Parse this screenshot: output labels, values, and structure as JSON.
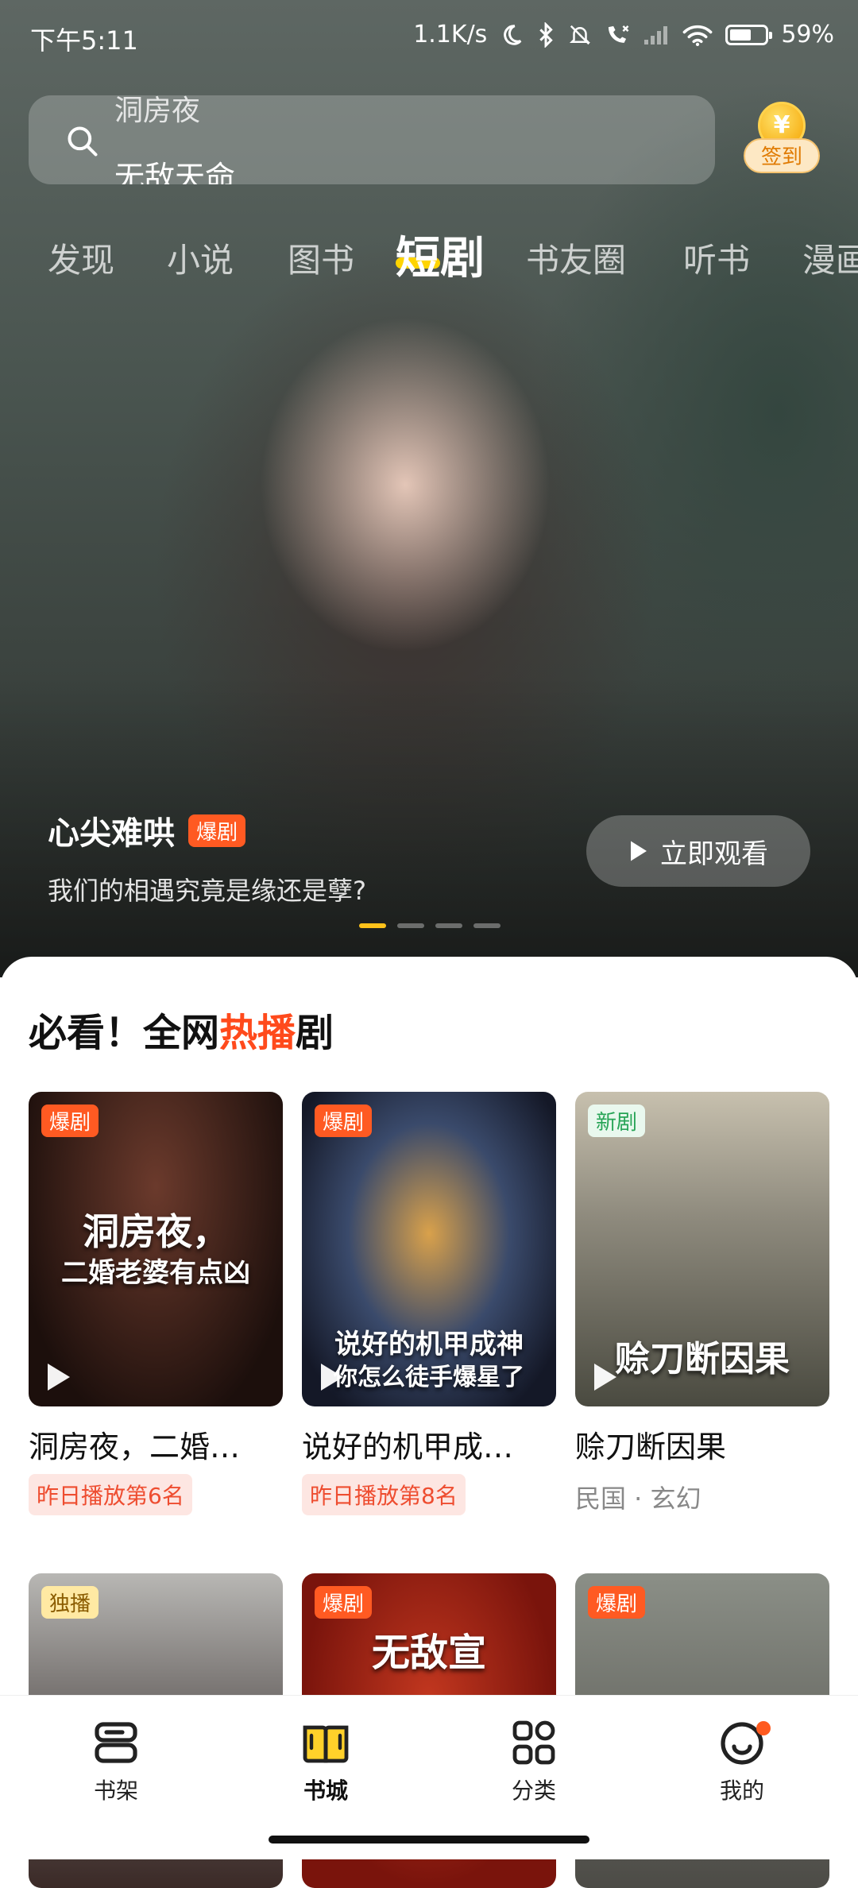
{
  "status_bar": {
    "time": "下午5:11",
    "speed": "1.1K/s",
    "battery": "59%"
  },
  "search": {
    "prev_placeholder": "洞房夜",
    "placeholder": "无敌天命",
    "search_icon": "search-icon"
  },
  "signin": {
    "label": "签到",
    "coin_symbol": "¥"
  },
  "tabs": [
    {
      "label": "发现"
    },
    {
      "label": "小说"
    },
    {
      "label": "图书"
    },
    {
      "label": "短剧"
    },
    {
      "label": "书友圈"
    },
    {
      "label": "听书"
    },
    {
      "label": "漫画"
    }
  ],
  "hero": {
    "title": "心尖难哄",
    "tag": "爆剧",
    "subtitle": "我们的相遇究竟是缘还是孽?",
    "watch_label": "立即观看",
    "active_slide_index": 0,
    "slide_count": 4
  },
  "section": {
    "title_prefix": "必看！全网",
    "title_highlight": "热播",
    "title_suffix": "剧"
  },
  "cards": [
    {
      "tag": "爆剧",
      "title": "洞房夜，二婚…",
      "meta": "昨日播放第6名",
      "poster_text": [
        "洞房夜，",
        "二婚老婆有点凶"
      ]
    },
    {
      "tag": "爆剧",
      "title": "说好的机甲成…",
      "meta": "昨日播放第8名",
      "poster_text": [
        "说好的机甲成神",
        "你怎么徒手爆星了"
      ]
    },
    {
      "tag": "新剧",
      "title": "赊刀断因果",
      "meta": "民国 · 玄幻",
      "poster_text": [
        "赊刀断因果"
      ]
    },
    {
      "tag": "独播",
      "title": "",
      "meta": ""
    },
    {
      "tag": "爆剧",
      "title": "",
      "meta": "",
      "poster_text": [
        "无敌宣"
      ]
    },
    {
      "tag": "爆剧",
      "title": "",
      "meta": ""
    }
  ],
  "bottom_nav": [
    {
      "label": "书架",
      "icon": "bookshelf-icon"
    },
    {
      "label": "书城",
      "icon": "bookstore-icon"
    },
    {
      "label": "分类",
      "icon": "category-grid-icon"
    },
    {
      "label": "我的",
      "icon": "profile-icon"
    }
  ],
  "colors": {
    "accent": "#ff4a1c",
    "hot_tag": "#ff5a22",
    "new_tag": "#27a456",
    "tab_underline": "#ffd400",
    "active_dot": "#ffc21a"
  }
}
